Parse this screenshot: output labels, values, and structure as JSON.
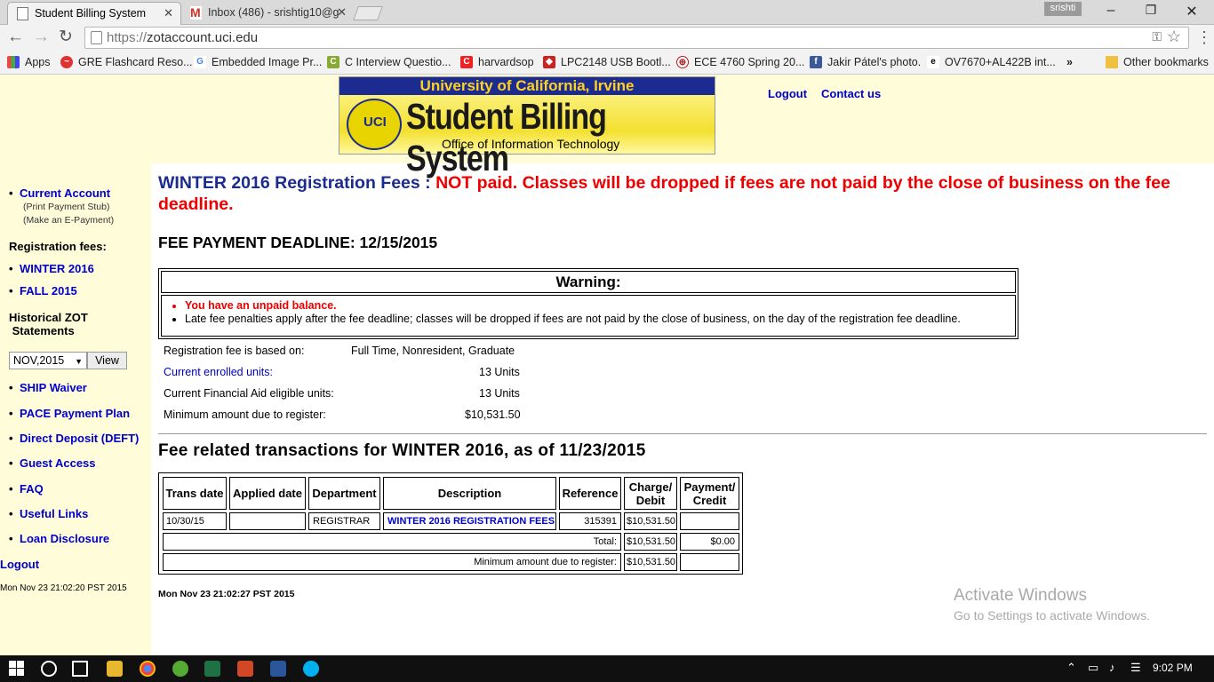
{
  "browser": {
    "tabs": [
      {
        "title": "Student Billing System",
        "active": true
      },
      {
        "title": "Inbox (486) - srishtig10@g",
        "active": false
      }
    ],
    "user_badge": "srishti",
    "url_scheme": "https://",
    "url_host": "zotaccount.uci.edu",
    "bookmarks": [
      {
        "label": "Apps",
        "icon": "apps-grid-icon"
      },
      {
        "label": "GRE Flashcard Reso...",
        "icon": "gre-icon"
      },
      {
        "label": "Embedded Image Pr...",
        "icon": "google-icon"
      },
      {
        "label": "C Interview Questio...",
        "icon": "interview-icon"
      },
      {
        "label": "harvardsop",
        "icon": "c-red-icon"
      },
      {
        "label": "LPC2148 USB Bootl...",
        "icon": "lpc-icon"
      },
      {
        "label": "ECE 4760 Spring 20...",
        "icon": "cornell-icon"
      },
      {
        "label": "Jakir Pátel's photo.",
        "icon": "facebook-icon"
      },
      {
        "label": "OV7670+AL422B int...",
        "icon": "ie-icon"
      }
    ],
    "bookmarks_overflow": "»",
    "other_bookmarks": "Other bookmarks"
  },
  "banner": {
    "line1": "University of California, Irvine",
    "line2": "Student Billing System",
    "line3": "Office of Information Technology",
    "logo_text": "UCI"
  },
  "header_links": {
    "logout": "Logout",
    "contact": "Contact us"
  },
  "sidebar": {
    "current_account": "Current Account",
    "print_stub": "(Print Payment Stub)",
    "make_epayment": "(Make an E-Payment)",
    "reg_fees_heading": "Registration fees:",
    "terms": [
      "WINTER 2016",
      "FALL 2015"
    ],
    "historical_heading_1": "Historical ZOT",
    "historical_heading_2": "Statements",
    "statement_selected": "NOV,2015",
    "view_button": "View",
    "links": [
      "SHIP Waiver",
      "PACE Payment Plan",
      "Direct Deposit (DEFT)",
      "Guest Access",
      "FAQ",
      "Useful Links",
      "Loan Disclosure"
    ],
    "logout": "Logout",
    "timestamp": "Mon Nov 23 21:02:20 PST 2015"
  },
  "main": {
    "reg_term": "WINTER 2016 Registration Fees",
    "reg_sep": " : ",
    "reg_status": "NOT paid. Classes will be dropped if fees are not paid by the close of business on the fee deadline.",
    "deadline": "FEE PAYMENT DEADLINE: 12/15/2015",
    "warning_title": "Warning:",
    "warning_items": [
      "You have an unpaid balance.",
      "Late fee penalties apply after the fee deadline; classes will be dropped if fees are not paid by the close of business, on the day of the registration fee deadline."
    ],
    "info": [
      {
        "label": "Registration fee is based on:",
        "value": "Full Time, Nonresident, Graduate"
      },
      {
        "label": "Current enrolled units:",
        "value": "13 Units"
      },
      {
        "label": "Current Financial Aid eligible units:",
        "value": "13 Units"
      },
      {
        "label": "Minimum amount due to register:",
        "value": "$10,531.50"
      }
    ],
    "tx_heading": "Fee related transactions for WINTER 2016, as of 11/23/2015",
    "tx_columns": [
      "Trans date",
      "Applied date",
      "Department",
      "Description",
      "Reference",
      "Charge/ Debit",
      "Payment/ Credit"
    ],
    "tx_rows": [
      {
        "trans_date": "10/30/15",
        "applied_date": "",
        "department": "REGISTRAR",
        "description": "WINTER 2016 REGISTRATION FEES",
        "reference": "315391",
        "charge": "$10,531.50",
        "payment": ""
      }
    ],
    "total_label": "Total:",
    "total_charge": "$10,531.50",
    "total_payment": "$0.00",
    "min_due_label": "Minimum amount due to register:",
    "min_due_charge": "$10,531.50",
    "timestamp": "Mon Nov 23 21:02:27 PST 2015"
  },
  "watermark": {
    "line1": "Activate Windows",
    "line2": "Go to Settings to activate Windows."
  },
  "taskbar": {
    "clock": "9:02 PM"
  },
  "colors": {
    "sidebar_bg": "#fffcd9",
    "link": "#0000cc",
    "alert": "#ee0000",
    "term_title": "#1c2b8f"
  }
}
